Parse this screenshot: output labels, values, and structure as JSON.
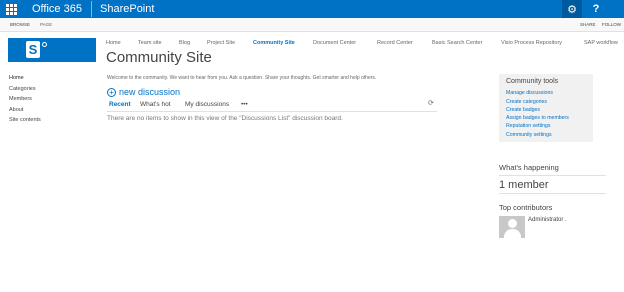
{
  "suite_bar": {
    "brand": "Office 365",
    "app": "SharePoint",
    "settings_glyph": "⚙",
    "help_glyph": "?",
    "icons": [
      "app-launcher-icon",
      "gear-icon",
      "help-icon"
    ]
  },
  "ribbon": {
    "tabs": [
      "BROWSE",
      "PAGE"
    ],
    "share": "SHARE",
    "follow": "FOLLOW"
  },
  "logo": {
    "letter": "S"
  },
  "top_nav": [
    "Home",
    "Team site",
    "Blog",
    "Project Site",
    "Community Site",
    "Document Center",
    "Record Center",
    "Basic Search Center",
    "Visio Process Repository",
    "SAP workflow"
  ],
  "page_title": "Community Site",
  "left_nav": [
    "Home",
    "Categories",
    "Members",
    "About",
    "Site contents"
  ],
  "welcome": "Welcome to the community. We want to hear from you. Ask a question. Share your thoughts. Get smarter and help others.",
  "new_discussion": "new discussion",
  "tabs": [
    "Recent",
    "What's hot",
    "My discussions",
    "•••"
  ],
  "empty_message": "There are no items to show in this view of the \"Discussions List\" discussion board.",
  "community_tools": {
    "title": "Community tools",
    "links": [
      "Manage discussions",
      "Create categories",
      "Create badges",
      "Assign badges to members",
      "Reputation settings",
      "Community settings"
    ]
  },
  "whats_happening": {
    "title": "What's happening",
    "members": "1 member"
  },
  "top_contributors": {
    "title": "Top contributors",
    "name": "Administrator ."
  },
  "colors": {
    "suite_bar": "#0072c6",
    "accent": "#0072c6",
    "tools_bg": "#f1f1f1"
  }
}
